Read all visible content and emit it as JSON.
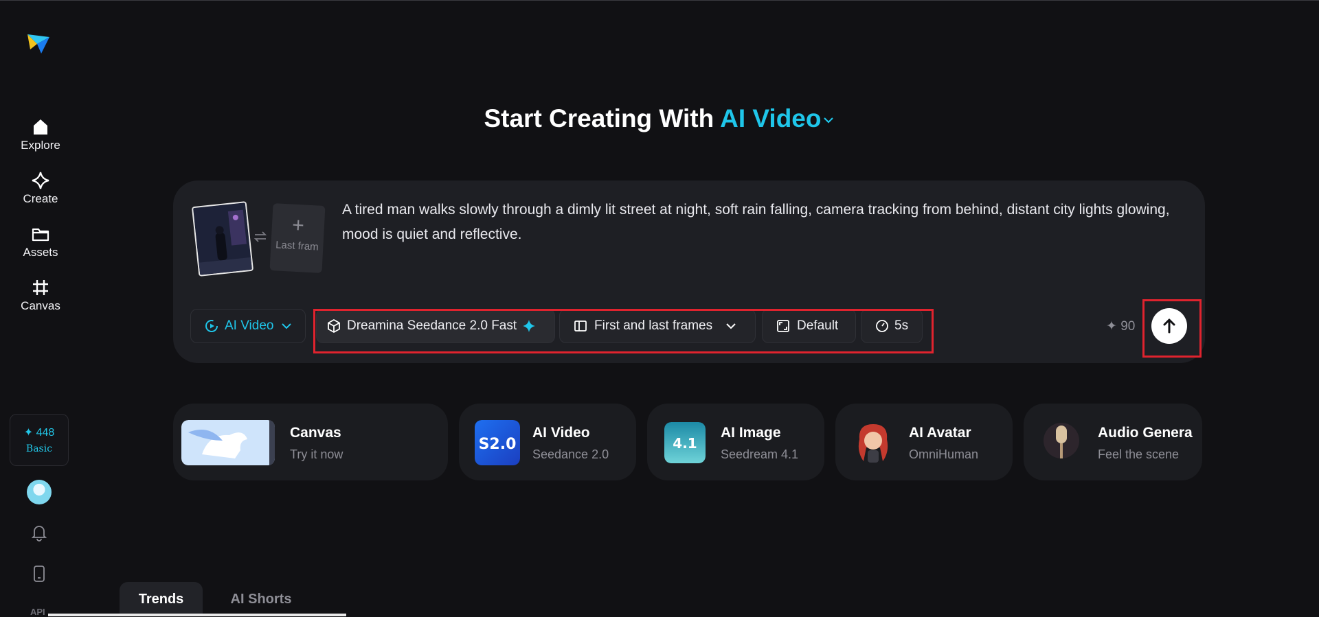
{
  "sidebar": {
    "logo_icon": "paper-plane-logo",
    "items": [
      {
        "label": "Explore",
        "icon": "home-icon"
      },
      {
        "label": "Create",
        "icon": "sparkle-diamond-icon"
      },
      {
        "label": "Assets",
        "icon": "folder-icon"
      },
      {
        "label": "Canvas",
        "icon": "crop-canvas-icon"
      }
    ],
    "credits": {
      "value": "448",
      "plan": "Basic",
      "icon": "sparkle-icon"
    },
    "bottom_icons": [
      "bell-icon",
      "phone-icon"
    ],
    "api_label": "API"
  },
  "header": {
    "title_prefix": "Start Creating With",
    "title_accent": "AI Video",
    "accent_color": "#1fc6ea"
  },
  "prompt": {
    "first_frame": "night street thumbnail",
    "last_frame_placeholder": "Last fram",
    "text": "A tired man walks slowly through a dimly lit street at night, soft rain falling, camera tracking from behind, distant city lights glowing, mood is quiet and reflective."
  },
  "toolbar": {
    "mode": "AI Video",
    "model": "Dreamina Seedance 2.0 Fast",
    "frames": "First and last frames",
    "ratio": "Default",
    "duration": "5s",
    "cost": "90"
  },
  "cards": [
    {
      "title": "Canvas",
      "subtitle": "Try it now"
    },
    {
      "title": "AI Video",
      "subtitle": "Seedance 2.0",
      "art_text": "S2.0"
    },
    {
      "title": "AI Image",
      "subtitle": "Seedream 4.1",
      "art_text": "4.1"
    },
    {
      "title": "AI Avatar",
      "subtitle": "OmniHuman"
    },
    {
      "title": "Audio Genera",
      "subtitle": "Feel the scene"
    }
  ],
  "tabs": [
    "Trends",
    "AI Shorts"
  ]
}
